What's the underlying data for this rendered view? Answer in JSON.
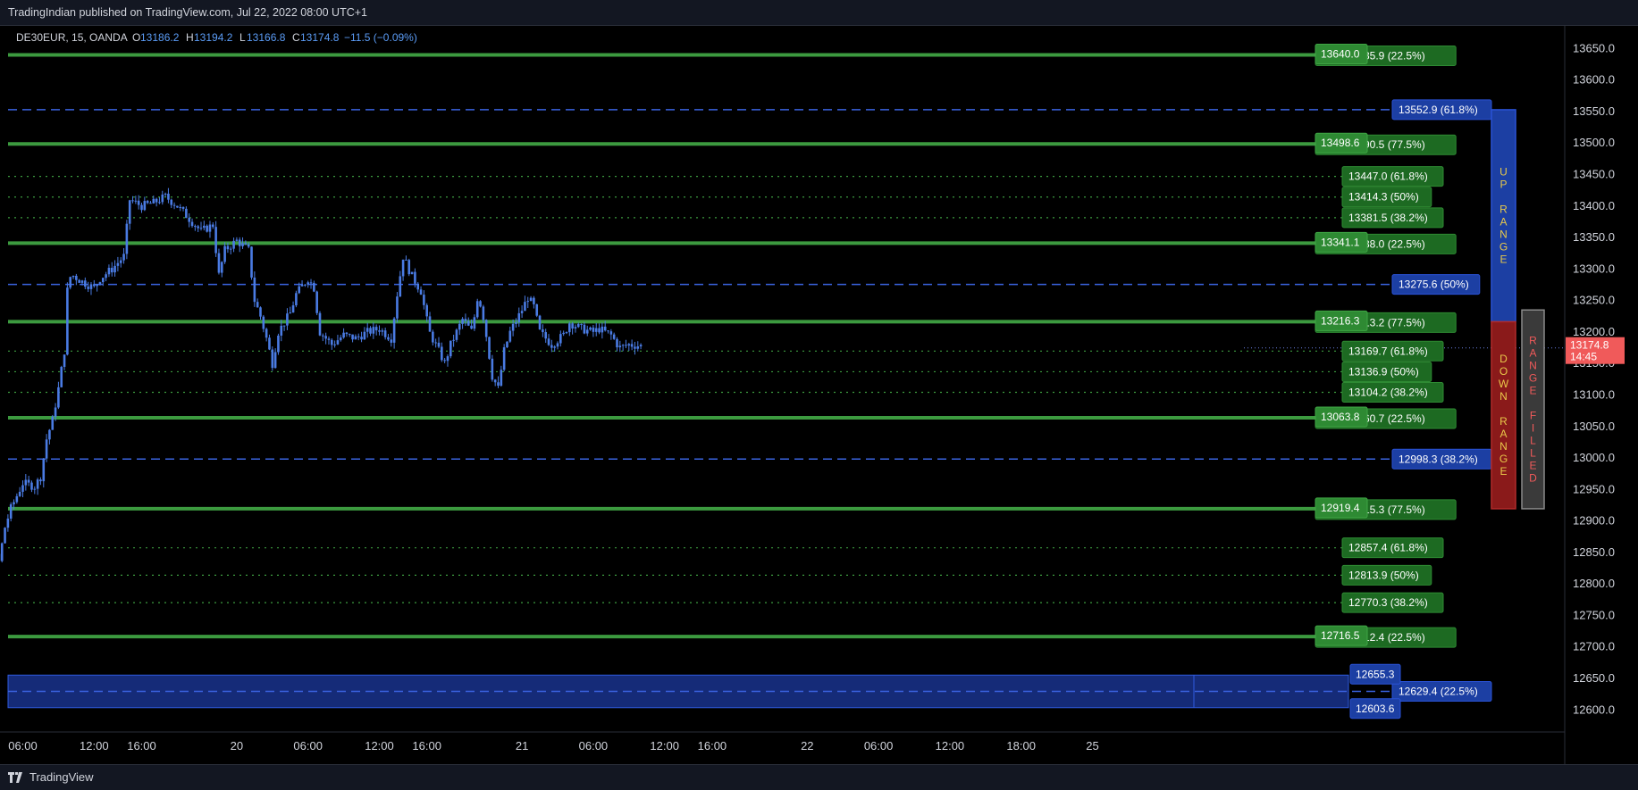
{
  "header": {
    "publish_text": "TradingIndian published on TradingView.com, Jul 22, 2022 08:00 UTC+1"
  },
  "footer": {
    "logo_text": "TradingView"
  },
  "legend": {
    "symbol": "DE30EUR, 15, OANDA",
    "o_label": "O",
    "o_value": "13186.2",
    "h_label": "H",
    "h_value": "13194.2",
    "l_label": "L",
    "l_value": "13166.8",
    "c_label": "C",
    "c_value": "13174.8",
    "change": "−11.5 (−0.09%)"
  },
  "colors": {
    "background": "#000000",
    "candle": "#4a7be3",
    "green_line": "#3c9a3f",
    "blue_line": "#2a52d6",
    "last_price": "#f05a5a",
    "up_range": "#1c3fa3",
    "down_range": "#8a1a1a"
  },
  "chart_data": {
    "type": "candlestick",
    "symbol": "DE30EUR",
    "interval": "15",
    "ylim": [
      12565,
      13686
    ],
    "y_ticks": [
      13650,
      13600,
      13550,
      13500,
      13450,
      13400,
      13350,
      13300,
      13250,
      13200,
      13150,
      13100,
      13050,
      13000,
      12950,
      12900,
      12850,
      12800,
      12750,
      12700,
      12650,
      12600
    ],
    "y_tick_labels": [
      "13650.0",
      "13600.0",
      "13550.0",
      "13500.0",
      "13450.0",
      "13400.0",
      "13350.0",
      "13300.0",
      "13250.0",
      "13200.0",
      "13150.0",
      "13100.0",
      "13050.0",
      "13000.0",
      "12950.0",
      "12900.0",
      "12850.0",
      "12800.0",
      "12750.0",
      "12700.0",
      "12650.0",
      "12600.0"
    ],
    "x_tick_labels": [
      "06:00",
      "12:00",
      "16:00",
      "20",
      "06:00",
      "12:00",
      "16:00",
      "21",
      "06:00",
      "12:00",
      "16:00",
      "22",
      "06:00",
      "12:00",
      "18:00",
      "25"
    ],
    "x_tick_hours": [
      6,
      12,
      16,
      24,
      30,
      36,
      40,
      48,
      54,
      60,
      64,
      72,
      78,
      84,
      90,
      96
    ],
    "last_price": {
      "value": 13174.8,
      "label": "13174.8",
      "countdown": "14:45"
    },
    "price_path": [
      [
        0,
        12855
      ],
      [
        1.5,
        12865
      ],
      [
        2.5,
        12870
      ],
      [
        3,
        12820
      ],
      [
        3.5,
        12850
      ],
      [
        4,
        12835
      ],
      [
        4.5,
        12890
      ],
      [
        5,
        12920
      ],
      [
        5.5,
        12940
      ],
      [
        6,
        12960
      ],
      [
        7,
        12955
      ],
      [
        7.5,
        12970
      ],
      [
        8,
        13030
      ],
      [
        8.5,
        13060
      ],
      [
        9,
        13110
      ],
      [
        9.5,
        13170
      ],
      [
        9.8,
        13285
      ],
      [
        10.2,
        13290
      ],
      [
        11,
        13280
      ],
      [
        12,
        13270
      ],
      [
        12.5,
        13285
      ],
      [
        13.5,
        13300
      ],
      [
        14.5,
        13320
      ],
      [
        15,
        13410
      ],
      [
        16,
        13400
      ],
      [
        17,
        13405
      ],
      [
        18,
        13415
      ],
      [
        19,
        13400
      ],
      [
        20,
        13380
      ],
      [
        21,
        13360
      ],
      [
        22,
        13370
      ],
      [
        22.5,
        13290
      ],
      [
        23,
        13330
      ],
      [
        24,
        13345
      ],
      [
        25,
        13330
      ],
      [
        25.5,
        13250
      ],
      [
        26,
        13225
      ],
      [
        26.5,
        13190
      ],
      [
        27,
        13150
      ],
      [
        27.5,
        13200
      ],
      [
        28.5,
        13230
      ],
      [
        29,
        13260
      ],
      [
        30,
        13285
      ],
      [
        30.5,
        13270
      ],
      [
        31,
        13200
      ],
      [
        32,
        13180
      ],
      [
        33,
        13195
      ],
      [
        34,
        13190
      ],
      [
        35,
        13200
      ],
      [
        36,
        13205
      ],
      [
        37,
        13190
      ],
      [
        37.5,
        13260
      ],
      [
        38,
        13320
      ],
      [
        38.7,
        13290
      ],
      [
        39.5,
        13265
      ],
      [
        40.2,
        13200
      ],
      [
        41,
        13170
      ],
      [
        41.5,
        13150
      ],
      [
        42,
        13180
      ],
      [
        43,
        13220
      ],
      [
        43.8,
        13200
      ],
      [
        44.3,
        13260
      ],
      [
        44.8,
        13220
      ],
      [
        45.5,
        13130
      ],
      [
        46,
        13110
      ],
      [
        46.5,
        13170
      ],
      [
        47,
        13200
      ],
      [
        48,
        13235
      ],
      [
        48.5,
        13255
      ],
      [
        49,
        13240
      ],
      [
        49.5,
        13200
      ],
      [
        50.5,
        13180
      ],
      [
        51.5,
        13195
      ],
      [
        52,
        13215
      ],
      [
        53,
        13205
      ],
      [
        54,
        13200
      ],
      [
        54.5,
        13205
      ],
      [
        55.5,
        13195
      ],
      [
        56.2,
        13175
      ],
      [
        57,
        13180
      ],
      [
        58,
        13178
      ]
    ],
    "levels_green_solid": [
      {
        "price": 13640.0,
        "label": "13640.0",
        "ext": "13631.9",
        "ext_tail": "35.9 (22.5%)"
      },
      {
        "price": 13498.6,
        "label": "13498.6",
        "ext": "13490.5",
        "ext_tail": "90.5 (77.5%)"
      },
      {
        "price": 13341.1,
        "label": "13341.1",
        "ext": "13338.0",
        "ext_tail": "38.0 (22.5%)"
      },
      {
        "price": 13216.3,
        "label": "13216.3",
        "ext": "13213.2",
        "ext_tail": "13.2 (77.5%)"
      },
      {
        "price": 13063.8,
        "label": "13063.8",
        "ext": "13060.7",
        "ext_tail": "60.7 (22.5%)"
      },
      {
        "price": 12919.4,
        "label": "12919.4",
        "ext": "12915.3",
        "ext_tail": "15.3 (77.5%)"
      },
      {
        "price": 12716.5,
        "label": "12716.5",
        "ext": "12712.4",
        "ext_tail": "12.4 (22.5%)"
      }
    ],
    "levels_green_dotted": [
      {
        "price": 13447.0,
        "label": "13447.0 (61.8%)"
      },
      {
        "price": 13414.3,
        "label": "13414.3 (50%)"
      },
      {
        "price": 13381.5,
        "label": "13381.5 (38.2%)"
      },
      {
        "price": 13169.7,
        "label": "13169.7 (61.8%)"
      },
      {
        "price": 13136.9,
        "label": "13136.9 (50%)"
      },
      {
        "price": 13104.2,
        "label": "13104.2 (38.2%)"
      },
      {
        "price": 12857.4,
        "label": "12857.4 (61.8%)"
      },
      {
        "price": 12813.9,
        "label": "12813.9 (50%)"
      },
      {
        "price": 12770.3,
        "label": "12770.3 (38.2%)"
      }
    ],
    "levels_blue_dashed": [
      {
        "price": 13552.9,
        "label": "13552.9 (61.8%)"
      },
      {
        "price": 13275.6,
        "label": "13275.6 (50%)"
      },
      {
        "price": 12998.3,
        "label": "12998.3 (38.2%)"
      },
      {
        "price": 12629.4,
        "label": "12629.4 (22.5%)"
      }
    ],
    "zone": {
      "top": 12655.3,
      "bottom": 12603.6,
      "top_label": "12655.3",
      "bottom_label": "12603.6"
    },
    "range_boxes": {
      "up": {
        "from": 13216.3,
        "to": 13552.9,
        "text": "UP RANGE"
      },
      "down": {
        "from": 12919.4,
        "to": 13216.3,
        "text": "DOWN RANGE"
      },
      "filled": {
        "from": 12919.4,
        "to": 13235,
        "text": "RANGE FILLED"
      }
    }
  }
}
